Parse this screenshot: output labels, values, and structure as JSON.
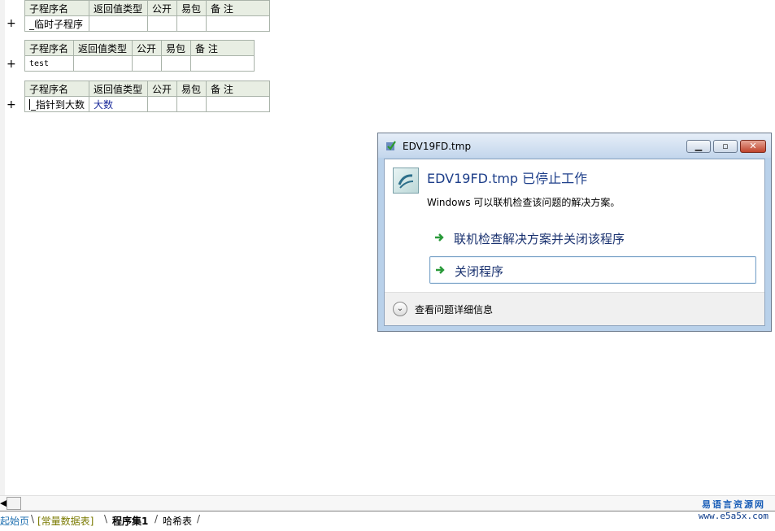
{
  "tables": [
    {
      "headers": [
        "子程序名",
        "返回值类型",
        "公开",
        "易包",
        "备 注"
      ],
      "row": [
        "_临时子程序",
        "",
        "",
        "",
        ""
      ]
    },
    {
      "headers": [
        "子程序名",
        "返回值类型",
        "公开",
        "易包",
        "备 注"
      ],
      "row": [
        "test",
        "",
        "",
        "",
        ""
      ]
    },
    {
      "headers": [
        "子程序名",
        "返回值类型",
        "公开",
        "易包",
        "备 注"
      ],
      "row": [
        "_指针到大数",
        "大数",
        "",
        "",
        ""
      ]
    }
  ],
  "expander_glyph": "+",
  "dialog": {
    "title": "EDV19FD.tmp",
    "heading": "EDV19FD.tmp 已停止工作",
    "description": "Windows 可以联机检查该问题的解决方案。",
    "option_check_online": "联机检查解决方案并关闭该程序",
    "option_close": "关闭程序",
    "details": "查看问题详细信息",
    "accent_color": "#1e3f8a"
  },
  "tabs": [
    "起始页",
    "[常量数据表]",
    "程序集1",
    "哈希表"
  ],
  "watermark": {
    "name": "易语言资源网",
    "url": "www.e5a5x.com"
  }
}
